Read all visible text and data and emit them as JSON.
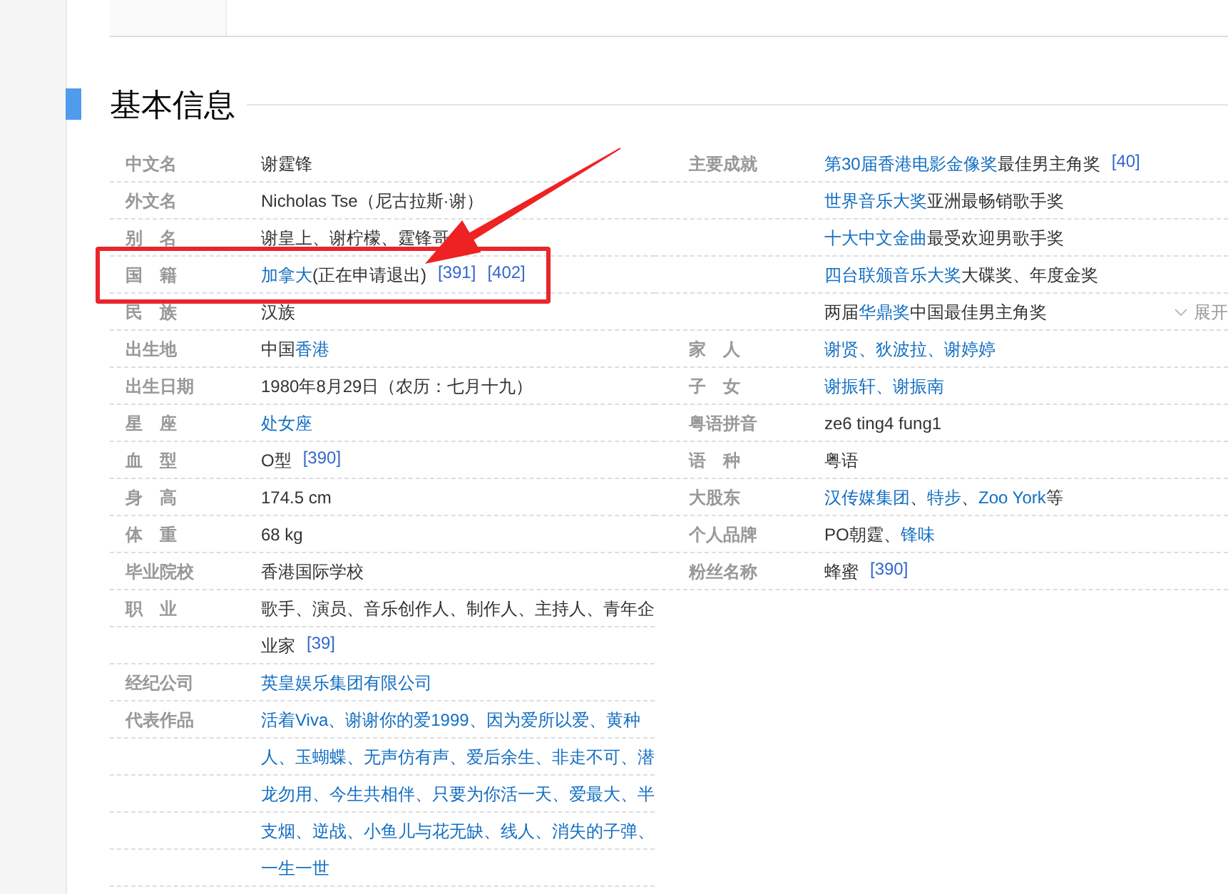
{
  "section": {
    "title": "基本信息"
  },
  "left_rows": [
    {
      "label": "中文名",
      "highlighted": false,
      "lines": [
        {
          "parts": [
            {
              "kind": "text",
              "text": "谢霆锋"
            }
          ]
        }
      ]
    },
    {
      "label": "外文名",
      "highlighted": false,
      "lines": [
        {
          "parts": [
            {
              "kind": "text",
              "text": "Nicholas Tse（尼古拉斯·谢）"
            }
          ]
        }
      ]
    },
    {
      "label": "别　名",
      "highlighted": false,
      "lines": [
        {
          "parts": [
            {
              "kind": "text",
              "text": "谢皇上、谢柠檬、霆锋哥"
            }
          ]
        }
      ]
    },
    {
      "label": "国　籍",
      "highlighted": true,
      "lines": [
        {
          "parts": [
            {
              "kind": "link",
              "text": "加拿大"
            },
            {
              "kind": "text",
              "text": "(正在申请退出)"
            },
            {
              "kind": "ref",
              "text": "[391]"
            },
            {
              "kind": "ref",
              "text": "[402]"
            }
          ]
        }
      ]
    },
    {
      "label": "民　族",
      "highlighted": false,
      "lines": [
        {
          "parts": [
            {
              "kind": "text",
              "text": "汉族"
            }
          ]
        }
      ]
    },
    {
      "label": "出生地",
      "highlighted": false,
      "lines": [
        {
          "parts": [
            {
              "kind": "text",
              "text": "中国"
            },
            {
              "kind": "link",
              "text": "香港"
            }
          ]
        }
      ]
    },
    {
      "label": "出生日期",
      "highlighted": false,
      "lines": [
        {
          "parts": [
            {
              "kind": "text",
              "text": "1980年8月29日（农历：七月十九）"
            }
          ]
        }
      ]
    },
    {
      "label": "星　座",
      "highlighted": false,
      "lines": [
        {
          "parts": [
            {
              "kind": "link",
              "text": "处女座"
            }
          ]
        }
      ]
    },
    {
      "label": "血　型",
      "highlighted": false,
      "lines": [
        {
          "parts": [
            {
              "kind": "text",
              "text": "O型"
            },
            {
              "kind": "ref",
              "text": "[390]"
            }
          ]
        }
      ]
    },
    {
      "label": "身　高",
      "highlighted": false,
      "lines": [
        {
          "parts": [
            {
              "kind": "text",
              "text": "174.5 cm"
            }
          ]
        }
      ]
    },
    {
      "label": "体　重",
      "highlighted": false,
      "lines": [
        {
          "parts": [
            {
              "kind": "text",
              "text": "68 kg"
            }
          ]
        }
      ]
    },
    {
      "label": "毕业院校",
      "highlighted": false,
      "lines": [
        {
          "parts": [
            {
              "kind": "text",
              "text": "香港国际学校"
            }
          ]
        }
      ]
    },
    {
      "label": "职　业",
      "highlighted": false,
      "lines": [
        {
          "parts": [
            {
              "kind": "text",
              "text": "歌手、演员、音乐创作人、制作人、主持人、青年企"
            }
          ]
        },
        {
          "parts": [
            {
              "kind": "text",
              "text": "业家"
            },
            {
              "kind": "ref",
              "text": "[39]"
            }
          ]
        }
      ]
    },
    {
      "label": "经纪公司",
      "highlighted": false,
      "lines": [
        {
          "parts": [
            {
              "kind": "link",
              "text": "英皇娱乐集团有限公司"
            }
          ]
        }
      ]
    },
    {
      "label": "代表作品",
      "highlighted": false,
      "lines": [
        {
          "parts": [
            {
              "kind": "link",
              "text": "活着Viva、谢谢你的爱1999、因为爱所以爱、黄种"
            }
          ]
        },
        {
          "parts": [
            {
              "kind": "link",
              "text": "人、玉蝴蝶、无声仿有声、爱后余生、非走不可、潜"
            }
          ]
        },
        {
          "parts": [
            {
              "kind": "link",
              "text": "龙勿用、今生共相伴、只要为你活一天、爱最大、半"
            }
          ]
        },
        {
          "parts": [
            {
              "kind": "link",
              "text": "支烟、逆战、小鱼儿与花无缺、线人、消失的子弹、"
            }
          ]
        },
        {
          "parts": [
            {
              "kind": "link",
              "text": "一生一世"
            }
          ]
        }
      ]
    }
  ],
  "right_rows": [
    {
      "label": "主要成就",
      "highlighted": false,
      "lines": [
        {
          "parts": [
            {
              "kind": "link",
              "text": "第30届香港电影金像奖"
            },
            {
              "kind": "text",
              "text": "最佳男主角奖"
            },
            {
              "kind": "ref",
              "text": "[40]"
            }
          ]
        },
        {
          "parts": [
            {
              "kind": "link",
              "text": "世界音乐大奖"
            },
            {
              "kind": "text",
              "text": "亚洲最畅销歌手奖"
            }
          ]
        },
        {
          "parts": [
            {
              "kind": "link",
              "text": "十大中文金曲"
            },
            {
              "kind": "text",
              "text": "最受欢迎男歌手奖"
            }
          ]
        },
        {
          "parts": [
            {
              "kind": "link",
              "text": "四台联颁音乐大奖"
            },
            {
              "kind": "text",
              "text": "大碟奖、年度金奖"
            }
          ]
        },
        {
          "parts": [
            {
              "kind": "text",
              "text": "两届"
            },
            {
              "kind": "link",
              "text": "华鼎奖"
            },
            {
              "kind": "text",
              "text": "中国最佳男主角奖"
            }
          ],
          "toggle": "展开"
        }
      ]
    },
    {
      "label": "家　人",
      "highlighted": false,
      "lines": [
        {
          "parts": [
            {
              "kind": "link",
              "text": "谢贤、狄波拉、谢婷婷"
            }
          ]
        }
      ]
    },
    {
      "label": "子　女",
      "highlighted": false,
      "lines": [
        {
          "parts": [
            {
              "kind": "link",
              "text": "谢振轩、谢振南"
            }
          ]
        }
      ]
    },
    {
      "label": "粤语拼音",
      "highlighted": false,
      "lines": [
        {
          "parts": [
            {
              "kind": "text",
              "text": "ze6 ting4 fung1"
            }
          ]
        }
      ]
    },
    {
      "label": "语　种",
      "highlighted": false,
      "lines": [
        {
          "parts": [
            {
              "kind": "text",
              "text": "粤语"
            }
          ]
        }
      ]
    },
    {
      "label": "大股东",
      "highlighted": false,
      "lines": [
        {
          "parts": [
            {
              "kind": "link",
              "text": "汉传媒集团"
            },
            {
              "kind": "text",
              "text": "、"
            },
            {
              "kind": "link",
              "text": "特步"
            },
            {
              "kind": "text",
              "text": "、"
            },
            {
              "kind": "link",
              "text": "Zoo York"
            },
            {
              "kind": "text",
              "text": "等"
            }
          ]
        }
      ]
    },
    {
      "label": "个人品牌",
      "highlighted": false,
      "lines": [
        {
          "parts": [
            {
              "kind": "text",
              "text": "PO朝霆、"
            },
            {
              "kind": "link",
              "text": "锋味"
            }
          ]
        }
      ]
    },
    {
      "label": "粉丝名称",
      "highlighted": false,
      "lines": [
        {
          "parts": [
            {
              "kind": "text",
              "text": "蜂蜜"
            },
            {
              "kind": "ref",
              "text": "[390]"
            }
          ]
        }
      ]
    }
  ]
}
